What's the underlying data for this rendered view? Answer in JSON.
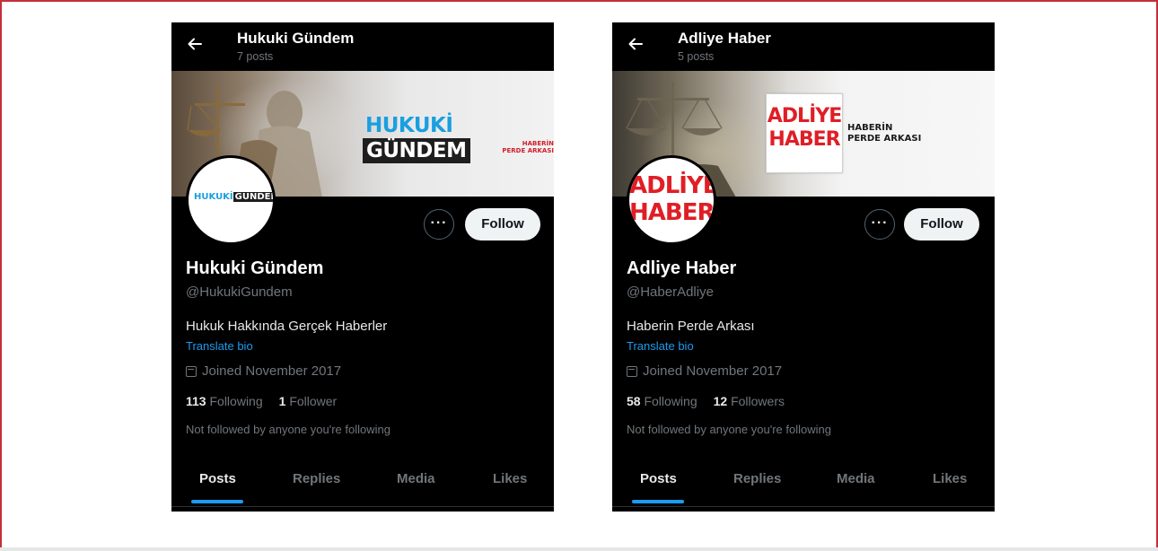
{
  "colors": {
    "accent": "#1d9bf0",
    "background": "#000000",
    "frame": "#c2303a",
    "logo_red": "#e01e26",
    "logo_blue": "#1a9fe0"
  },
  "profiles": [
    {
      "title": "Hukuki Gündem",
      "post_count": "7 posts",
      "banner_logo": {
        "part1": "HUKUKİ",
        "part2": "GÜNDEM",
        "sub_line1": "HABERİN",
        "sub_line2": "PERDE ARKASI"
      },
      "avatar_logo": {
        "part1": "HUKUKİ",
        "part2": "GÜNDEM"
      },
      "more_label": "···",
      "follow_label": "Follow",
      "display_name": "Hukuki Gündem",
      "handle": "@HukukiGundem",
      "bio": "Hukuk Hakkında Gerçek Haberler",
      "translate_label": "Translate bio",
      "joined": "Joined November 2017",
      "following_count": "113",
      "following_label": "Following",
      "followers_count": "1",
      "followers_label": "Follower",
      "not_followed": "Not followed by anyone you're following",
      "tabs": [
        "Posts",
        "Replies",
        "Media",
        "Likes"
      ],
      "icons": {
        "back": "back-arrow-icon",
        "calendar": "calendar-icon"
      }
    },
    {
      "title": "Adliye Haber",
      "post_count": "5 posts",
      "banner_logo": {
        "line1": "ADLİYE",
        "line2": "HABER",
        "tag_line1": "HABERİN",
        "tag_line2": "PERDE ARKASI"
      },
      "avatar_logo": {
        "line1": "ADLİYE",
        "line2": "HABER"
      },
      "more_label": "···",
      "follow_label": "Follow",
      "display_name": "Adliye Haber",
      "handle": "@HaberAdliye",
      "bio": "Haberin Perde Arkası",
      "translate_label": "Translate bio",
      "joined": "Joined November 2017",
      "following_count": "58",
      "following_label": "Following",
      "followers_count": "12",
      "followers_label": "Followers",
      "not_followed": "Not followed by anyone you're following",
      "tabs": [
        "Posts",
        "Replies",
        "Media",
        "Likes"
      ],
      "icons": {
        "back": "back-arrow-icon",
        "calendar": "calendar-icon"
      }
    }
  ]
}
